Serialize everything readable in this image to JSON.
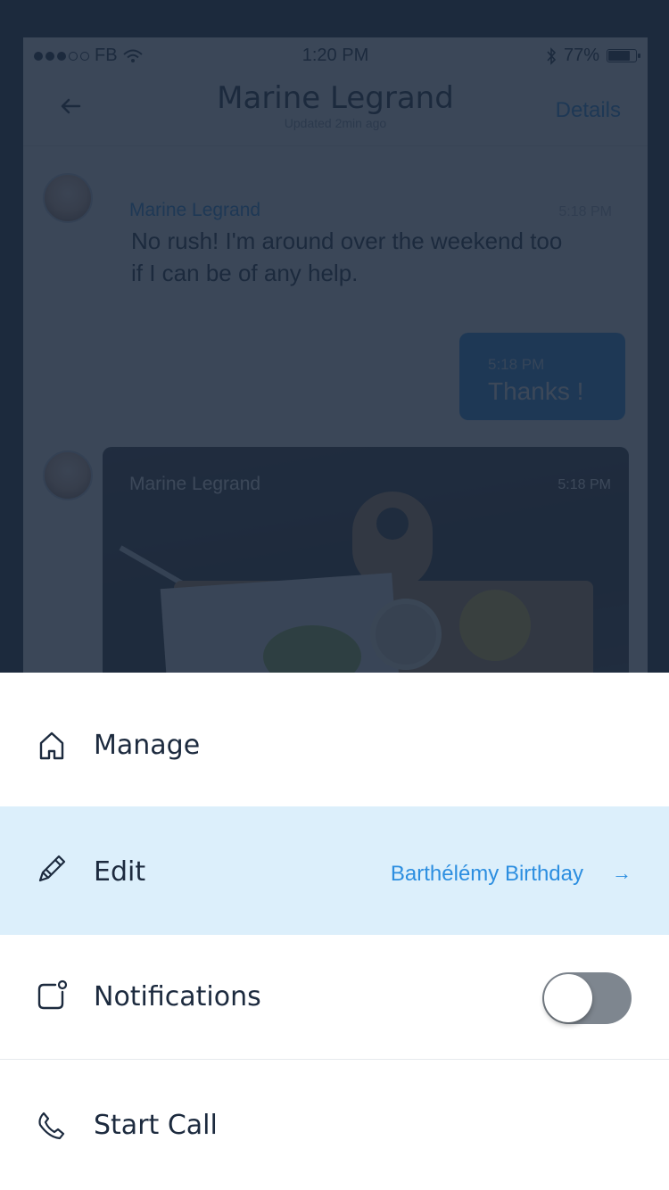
{
  "status_bar": {
    "carrier": "FB",
    "time": "1:20 PM",
    "battery": "77%",
    "battery_level": 0.77
  },
  "nav": {
    "title": "Marine Legrand",
    "subtitle": "Updated 2min ago",
    "details_label": "Details"
  },
  "messages": [
    {
      "sender": "Marine Legrand",
      "time": "5:18 PM",
      "text": "No rush! I'm around over the weekend too if I can be of any help."
    },
    {
      "sender": "me",
      "time": "5:18 PM",
      "text": "Thanks !"
    },
    {
      "sender": "Marine Legrand",
      "time": "5:18 PM",
      "type": "photo"
    }
  ],
  "sheet": {
    "items": [
      {
        "label": "Manage",
        "icon": "home-icon"
      },
      {
        "label": "Edit",
        "icon": "pencil-icon",
        "value": "Barthélémy Birthday",
        "arrow": "→",
        "highlighted": true
      },
      {
        "label": "Notifications",
        "icon": "notification-icon",
        "toggle": false
      },
      {
        "label": "Start Call",
        "icon": "phone-icon"
      }
    ]
  },
  "colors": {
    "accent": "#2c8ee0",
    "text": "#1c2a3e",
    "highlight_row": "#dceffb",
    "overlay": "#1c2a3e"
  }
}
